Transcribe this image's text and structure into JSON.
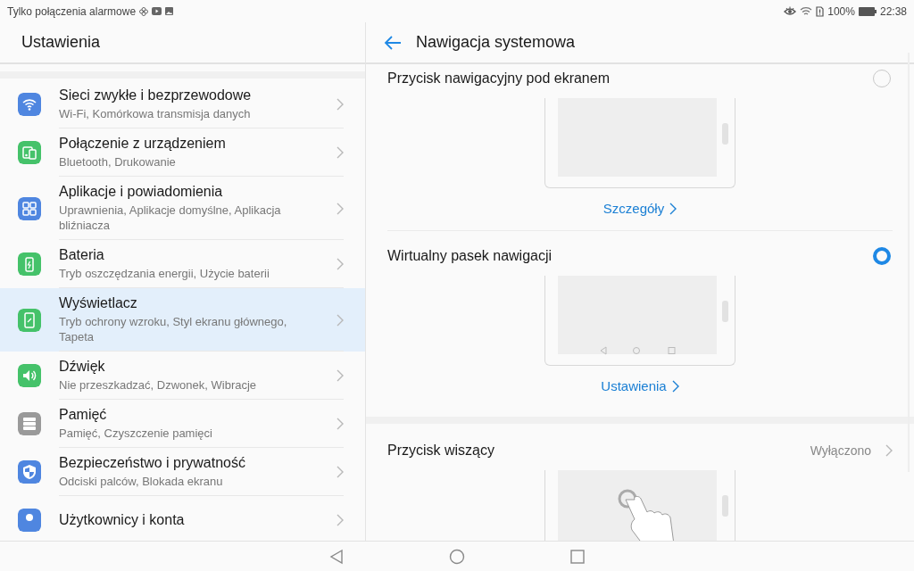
{
  "status_bar": {
    "notification": "Tylko połączenia alarmowe",
    "battery": "100%",
    "time": "22:38"
  },
  "settings": {
    "title": "Ustawienia",
    "items": [
      {
        "title": "Sieci zwykłe i bezprzewodowe",
        "subtitle": "Wi-Fi, Komórkowa transmisja danych",
        "color": "#4f86e0",
        "selected": false
      },
      {
        "title": "Połączenie z urządzeniem",
        "subtitle": "Bluetooth, Drukowanie",
        "color": "#45c26a",
        "selected": false
      },
      {
        "title": "Aplikacje i powiadomienia",
        "subtitle": "Uprawnienia, Aplikacje domyślne, Aplikacja bliźniacza",
        "color": "#4f86e0",
        "selected": false
      },
      {
        "title": "Bateria",
        "subtitle": "Tryb oszczędzania energii, Użycie baterii",
        "color": "#45c26a",
        "selected": false
      },
      {
        "title": "Wyświetlacz",
        "subtitle": "Tryb ochrony wzroku, Styl ekranu głównego, Tapeta",
        "color": "#45c26a",
        "selected": true
      },
      {
        "title": "Dźwięk",
        "subtitle": "Nie przeszkadzać, Dzwonek, Wibracje",
        "color": "#45c26a",
        "selected": false
      },
      {
        "title": "Pamięć",
        "subtitle": "Pamięć, Czyszczenie pamięci",
        "color": "#9a9a9a",
        "selected": false
      },
      {
        "title": "Bezpieczeństwo i prywatność",
        "subtitle": "Odciski palców, Blokada ekranu",
        "color": "#4f86e0",
        "selected": false
      },
      {
        "title": "Użytkownicy i konta",
        "color": "#4f86e0",
        "selected": false
      }
    ]
  },
  "detail": {
    "title": "Nawigacja systemowa",
    "options": [
      {
        "kind": "radio",
        "label": "Przycisk nawigacyjny pod ekranem",
        "selected": false,
        "link": "Szczegóły"
      },
      {
        "kind": "radio",
        "label": "Wirtualny pasek nawigacji",
        "selected": true,
        "link": "Ustawienia"
      },
      {
        "kind": "value",
        "label": "Przycisk wiszący",
        "value": "Wyłączono"
      }
    ]
  }
}
